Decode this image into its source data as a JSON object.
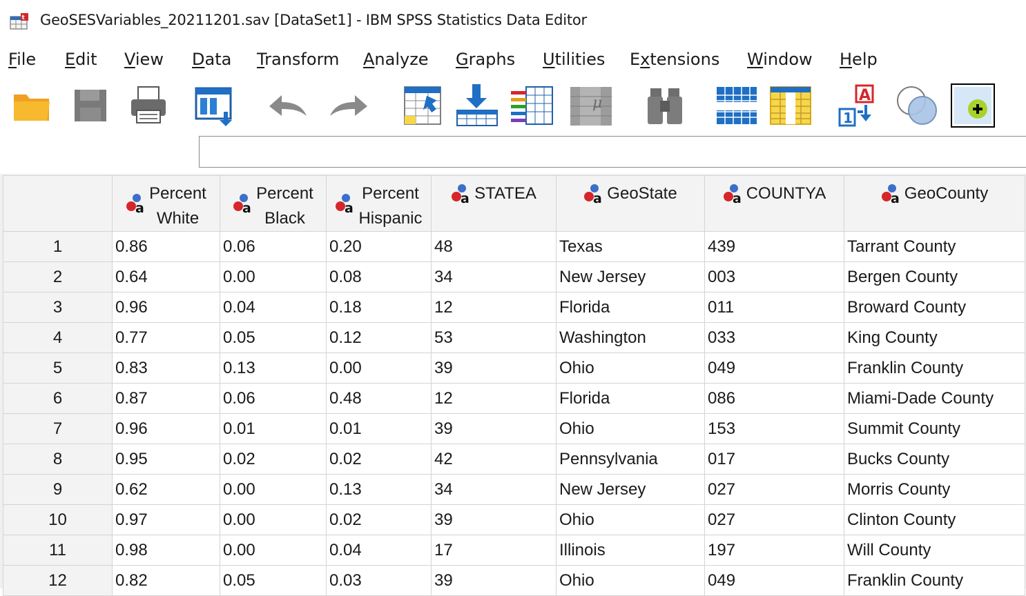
{
  "window": {
    "title": "GeoSESVariables_20211201.sav [DataSet1] - IBM SPSS Statistics Data Editor"
  },
  "menu": [
    {
      "label": "File",
      "mnemonic": "F",
      "rest": "ile"
    },
    {
      "label": "Edit",
      "mnemonic": "E",
      "rest": "dit"
    },
    {
      "label": "View",
      "mnemonic": "V",
      "rest": "iew"
    },
    {
      "label": "Data",
      "mnemonic": "D",
      "rest": "ata"
    },
    {
      "label": "Transform",
      "mnemonic": "T",
      "rest": "ransform"
    },
    {
      "label": "Analyze",
      "mnemonic": "A",
      "rest": "nalyze"
    },
    {
      "label": "Graphs",
      "mnemonic": "G",
      "rest": "raphs"
    },
    {
      "label": "Utilities",
      "mnemonic": "U",
      "rest": "tilities"
    },
    {
      "label": "Extensions",
      "pre": "E",
      "mnemonic": "x",
      "rest": "tensions"
    },
    {
      "label": "Window",
      "mnemonic": "W",
      "rest": "indow"
    },
    {
      "label": "Help",
      "mnemonic": "H",
      "rest": "elp"
    }
  ],
  "toolbar": [
    {
      "icon": "open-folder-icon"
    },
    {
      "icon": "save-icon"
    },
    {
      "icon": "print-icon"
    },
    {
      "icon": "recall-dialog-icon"
    },
    {
      "icon": "undo-icon"
    },
    {
      "icon": "redo-icon"
    },
    {
      "icon": "goto-case-icon"
    },
    {
      "icon": "goto-variable-icon"
    },
    {
      "icon": "variables-icon"
    },
    {
      "icon": "run-descriptives-icon"
    },
    {
      "icon": "find-icon"
    },
    {
      "icon": "insert-cases-icon"
    },
    {
      "icon": "insert-variable-icon"
    },
    {
      "icon": "value-labels-icon"
    },
    {
      "icon": "use-sets-icon"
    },
    {
      "icon": "spelling-icon"
    }
  ],
  "cell_editor": {
    "value": ""
  },
  "columns": [
    {
      "line1": "Percent",
      "line2": "White",
      "type": "nominal-string"
    },
    {
      "line1": "Percent",
      "line2": "Black",
      "type": "nominal-string"
    },
    {
      "line1": "Percent",
      "line2": "Hispanic",
      "type": "nominal-string"
    },
    {
      "line1": "STATEA",
      "line2": "",
      "type": "nominal-string"
    },
    {
      "line1": "GeoState",
      "line2": "",
      "type": "nominal-string"
    },
    {
      "line1": "COUNTYA",
      "line2": "",
      "type": "nominal-string"
    },
    {
      "line1": "GeoCounty",
      "line2": "",
      "type": "nominal-string"
    }
  ],
  "rows": [
    {
      "n": "1",
      "cells": [
        "0.86",
        "0.06",
        "0.20",
        "48",
        "Texas",
        "439",
        "Tarrant County"
      ]
    },
    {
      "n": "2",
      "cells": [
        "0.64",
        "0.00",
        "0.08",
        "34",
        "New Jersey",
        "003",
        "Bergen County"
      ]
    },
    {
      "n": "3",
      "cells": [
        "0.96",
        "0.04",
        "0.18",
        "12",
        "Florida",
        "011",
        "Broward County"
      ]
    },
    {
      "n": "4",
      "cells": [
        "0.77",
        "0.05",
        "0.12",
        "53",
        "Washington",
        "033",
        "King County"
      ]
    },
    {
      "n": "5",
      "cells": [
        "0.83",
        "0.13",
        "0.00",
        "39",
        "Ohio",
        "049",
        "Franklin County"
      ]
    },
    {
      "n": "6",
      "cells": [
        "0.87",
        "0.06",
        "0.48",
        "12",
        "Florida",
        "086",
        "Miami-Dade County"
      ]
    },
    {
      "n": "7",
      "cells": [
        "0.96",
        "0.01",
        "0.01",
        "39",
        "Ohio",
        "153",
        "Summit County"
      ]
    },
    {
      "n": "8",
      "cells": [
        "0.95",
        "0.02",
        "0.02",
        "42",
        "Pennsylvania",
        "017",
        "Bucks County"
      ]
    },
    {
      "n": "9",
      "cells": [
        "0.62",
        "0.00",
        "0.13",
        "34",
        "New Jersey",
        "027",
        "Morris County"
      ]
    },
    {
      "n": "10",
      "cells": [
        "0.97",
        "0.00",
        "0.02",
        "39",
        "Ohio",
        "027",
        "Clinton County"
      ]
    },
    {
      "n": "11",
      "cells": [
        "0.98",
        "0.00",
        "0.04",
        "17",
        "Illinois",
        "197",
        "Will County"
      ]
    },
    {
      "n": "12",
      "cells": [
        "0.82",
        "0.05",
        "0.03",
        "39",
        "Ohio",
        "049",
        "Franklin County"
      ]
    }
  ],
  "colors": {
    "grid_border": "#d4d4d4",
    "header_bg": "#f3f3f3",
    "accent_blue": "#1f6fc5"
  }
}
